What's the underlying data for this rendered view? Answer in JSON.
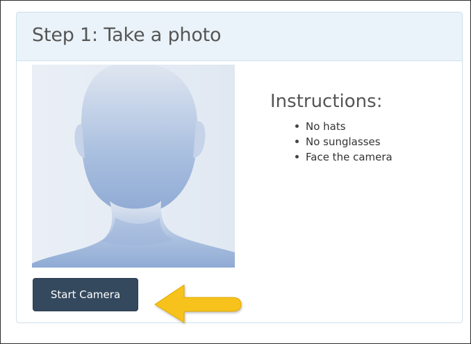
{
  "panel": {
    "title": "Step 1: Take a photo"
  },
  "photo": {
    "icon": "person-silhouette-icon"
  },
  "instructions": {
    "heading": "Instructions:",
    "items": [
      "No hats",
      "No sunglasses",
      "Face the camera"
    ]
  },
  "actions": {
    "start_camera_label": "Start Camera"
  },
  "annotation": {
    "icon": "arrow-left-icon",
    "color": "#f7c21a"
  },
  "colors": {
    "button_bg": "#34495e",
    "heading_bg": "#eaf3f9",
    "photo_figure": "#a9bfdf"
  }
}
